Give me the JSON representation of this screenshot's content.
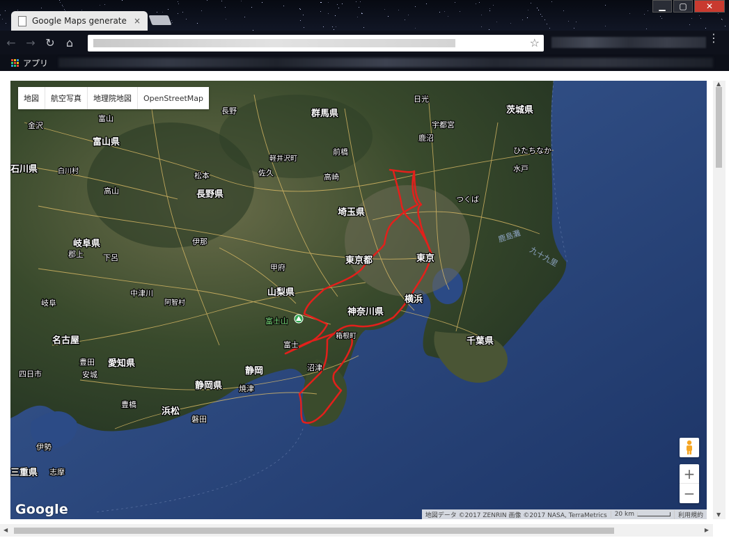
{
  "browser": {
    "tab_title": "Google Maps generate",
    "tab_close": "×",
    "bookmarks_apps": "アプリ",
    "bookmark_star": "☆",
    "menu": "⋮"
  },
  "map": {
    "map_types": [
      "地図",
      "航空写真",
      "地理院地図",
      "OpenStreetMap"
    ],
    "labels": {
      "gunma": "群馬県",
      "ibaraki": "茨城県",
      "nikko": "日光",
      "utsunomiya": "宇都宮",
      "kanuma": "鹿沼",
      "maebashi": "前橋",
      "hitachinaka": "ひたちなか",
      "mito": "水戸",
      "karuizawa": "軽井沢町",
      "takasaki": "高崎",
      "saku": "佐久",
      "matsumoto": "松本",
      "nagano_city": "長野",
      "nagano_pref": "長野県",
      "tsukuba": "つくば",
      "saitama": "埼玉県",
      "toyama_city": "富山",
      "toyama_pref": "富山県",
      "kanazawa": "金沢",
      "ishikawa": "石川県",
      "shirakawa": "白川村",
      "takayama": "高山",
      "gifu_pref": "岐阜県",
      "gujo": "郡上",
      "gero": "下呂",
      "ina": "伊那",
      "kofu": "甲府",
      "tokyo_to": "東京都",
      "tokyo": "東京",
      "yamanashi": "山梨県",
      "yokohama": "横浜",
      "kanagawa": "神奈川県",
      "nakatsugawa": "中津川",
      "achi": "阿智村",
      "gifu_city": "岐阜",
      "fujisan": "富士山",
      "hakone": "箱根町",
      "fuji": "富士",
      "chiba": "千葉県",
      "nagoya": "名古屋",
      "toyota": "豊田",
      "aichi": "愛知県",
      "yokkaichi": "四日市",
      "anjo": "安城",
      "numazu": "沼津",
      "shizuoka_city": "静岡",
      "shizuoka_pref": "静岡県",
      "yaizu": "焼津",
      "toyohashi": "豊橋",
      "hamamatsu": "浜松",
      "iwata": "磐田",
      "ise": "伊勢",
      "mie": "三重県",
      "shima": "志摩",
      "kashimanada": "鹿島灘",
      "kujukuri": "九十九里"
    },
    "route_color": "#e3201b",
    "attribution": "地図データ ©2017 ZENRIN 画像 ©2017 NASA, TerraMetrics",
    "scale": "20 km",
    "terms": "利用規約",
    "logo": "Google",
    "zoom_in": "+",
    "zoom_out": "−"
  }
}
